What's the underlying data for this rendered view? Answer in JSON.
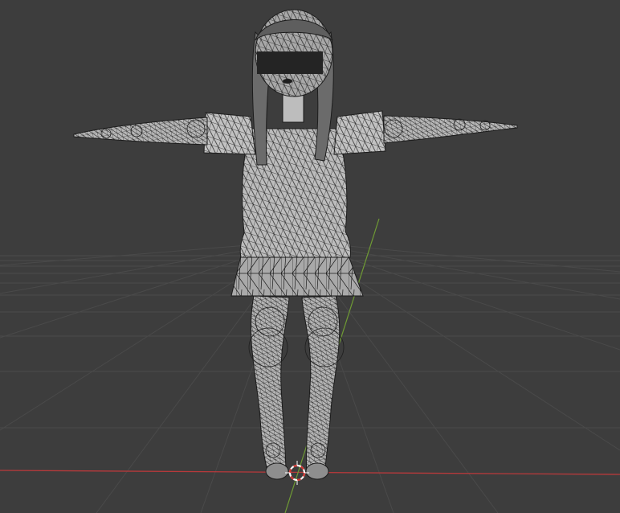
{
  "viewport": {
    "mode": "wireframe",
    "colors": {
      "background": "#3d3d3d",
      "grid_line": "#4a4a4a",
      "x_axis": "#b8393b",
      "y_axis": "#6f9b34",
      "mesh_fill": "#b9b9b9",
      "mesh_wire": "#1c1c1c",
      "censor_bar": "#242424"
    },
    "objects": [
      {
        "name": "character-mesh",
        "type": "mesh"
      },
      {
        "name": "armature",
        "type": "armature"
      },
      {
        "name": "3d-cursor",
        "type": "cursor"
      }
    ]
  }
}
